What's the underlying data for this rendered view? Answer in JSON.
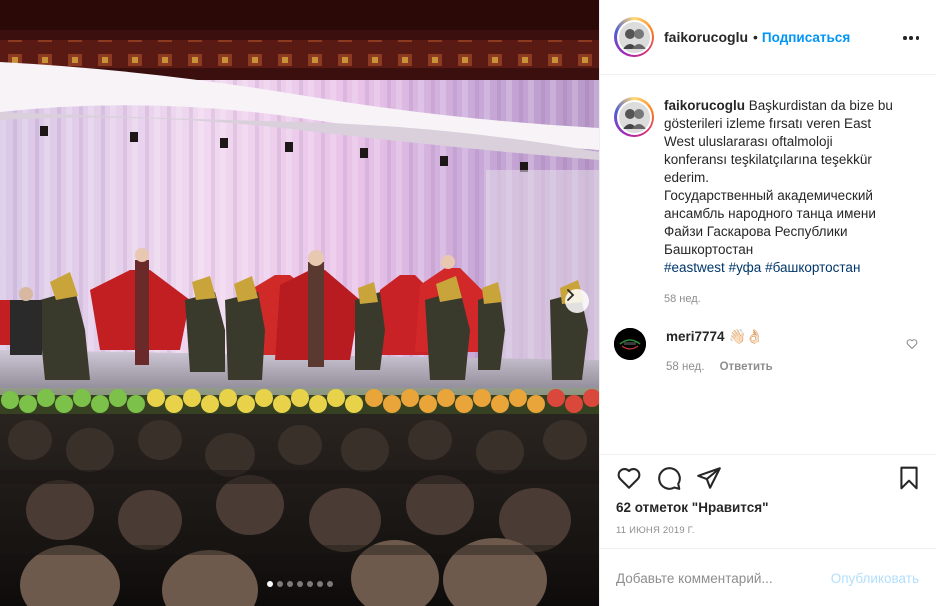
{
  "media": {
    "carousel_total": 7,
    "carousel_active_index": 0
  },
  "header": {
    "username": "faikorucoglu",
    "separator": "•",
    "follow_label": "Подписаться"
  },
  "caption": {
    "username": "faikorucoglu",
    "text_tr": "Başkurdistan da bize bu gösterileri izleme fırsatı veren East West uluslararası oftalmoloji konferansı teşkilatçılarına teşekkür ederim.",
    "text_ru": "Государственный академический ансамбль народного танца имени Файзи Гаскарова Республики Башкортостан",
    "hashtags": [
      "#eastwest",
      "#уфа",
      "#башкортостан"
    ],
    "time": "58 нед."
  },
  "comment": {
    "username": "meri7774",
    "emoji": "👋🏻👌🏻",
    "time": "58 нед.",
    "reply_label": "Ответить"
  },
  "actions": {
    "likes_text": "62 отметок \"Нравится\"",
    "date": "11 ИЮНЯ 2019 Г."
  },
  "add_comment": {
    "placeholder": "Добавьте комментарий...",
    "publish_label": "Опубликовать"
  }
}
